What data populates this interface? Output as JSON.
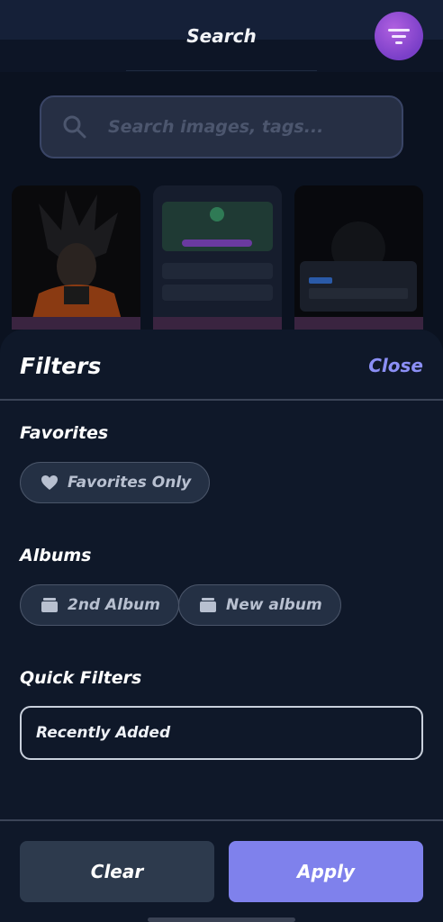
{
  "header": {
    "title": "Search"
  },
  "search": {
    "placeholder": "Search images, tags..."
  },
  "filters_sheet": {
    "title": "Filters",
    "close_label": "Close",
    "favorites": {
      "heading": "Favorites",
      "chip_label": "Favorites Only",
      "chip_icon": "heart-icon"
    },
    "albums": {
      "heading": "Albums",
      "items": [
        {
          "label": "2nd Album",
          "icon": "album-icon"
        },
        {
          "label": "New album",
          "icon": "album-icon"
        }
      ]
    },
    "quick_filters": {
      "heading": "Quick Filters",
      "selected": "Recently Added"
    },
    "clear_label": "Clear",
    "apply_label": "Apply"
  },
  "colors": {
    "accent": "#7f81ec",
    "sheet_background": "#0f1829",
    "chip_background": "#243044"
  }
}
